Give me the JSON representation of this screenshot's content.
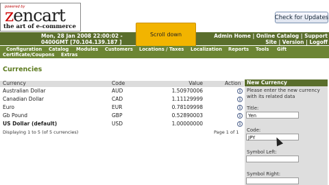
{
  "logo": {
    "powered_by": "powered by",
    "name": "zencart",
    "tagline": "the art of e-commerce"
  },
  "header": {
    "check_updates": "Check for Updates",
    "datetime_line1": "Mon, 28 Jan 2008 22:00:02 -",
    "datetime_line2": "0400GMT [70.104.139.187 ]",
    "links_line1": "Admin Home | Online Catalog | Support",
    "links_line2": "Site | Version | Logoff"
  },
  "overlay": {
    "label": "Scroll down"
  },
  "menu": {
    "items": [
      "Configuration",
      "Catalog",
      "Modules",
      "Customers",
      "Locations / Taxes",
      "Localization",
      "Reports",
      "Tools",
      "Gift",
      "Certificate/Coupons",
      "Extras"
    ]
  },
  "page": {
    "title": "Currencies"
  },
  "table": {
    "headers": {
      "currency": "Currency",
      "code": "Code",
      "value": "Value",
      "action": "Action"
    },
    "rows": [
      {
        "currency": "Australian Dollar",
        "code": "AUD",
        "value": "1.50970006"
      },
      {
        "currency": "Canadian Dollar",
        "code": "CAD",
        "value": "1.11129999"
      },
      {
        "currency": "Euro",
        "code": "EUR",
        "value": "0.78109998"
      },
      {
        "currency": "Gb Pound",
        "code": "GBP",
        "value": "0.52890003"
      },
      {
        "currency": "US Dollar (default)",
        "code": "USD",
        "value": "1.00000000"
      }
    ],
    "footer": {
      "displaying": "Displaying 1 to 5 (of 5 currencies)",
      "page": "Page 1 of 1"
    }
  },
  "panel": {
    "title": "New Currency",
    "intro": [
      "Please enter the new currency",
      "with its related data"
    ],
    "title_label": "Title:",
    "title_value": "Yen",
    "code_label": "Code:",
    "code_value": "JPY",
    "symbol_left_label": "Symbol Left:",
    "symbol_right_label": "Symbol Right:"
  }
}
